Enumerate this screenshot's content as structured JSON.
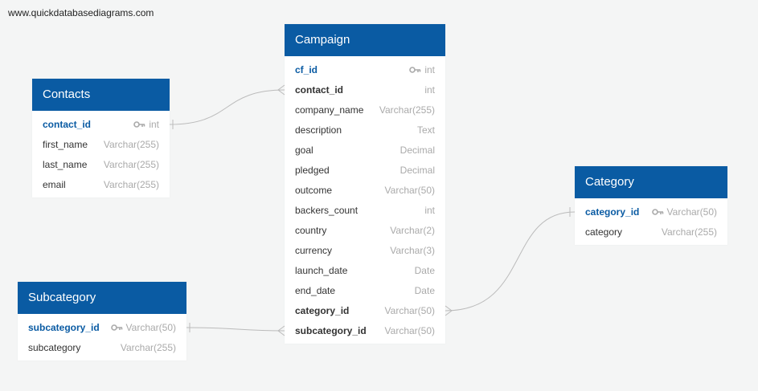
{
  "watermark": "www.quickdatabasediagrams.com",
  "colors": {
    "header": "#0a5ba3",
    "link": "#bbbbbb"
  },
  "tables": {
    "contacts": {
      "name": "Contacts",
      "fields": [
        {
          "name": "contact_id",
          "type": "int",
          "pk": true
        },
        {
          "name": "first_name",
          "type": "Varchar(255)"
        },
        {
          "name": "last_name",
          "type": "Varchar(255)"
        },
        {
          "name": "email",
          "type": "Varchar(255)"
        }
      ]
    },
    "campaign": {
      "name": "Campaign",
      "fields": [
        {
          "name": "cf_id",
          "type": "int",
          "pk": true
        },
        {
          "name": "contact_id",
          "type": "int",
          "fk": true
        },
        {
          "name": "company_name",
          "type": "Varchar(255)"
        },
        {
          "name": "description",
          "type": "Text"
        },
        {
          "name": "goal",
          "type": "Decimal"
        },
        {
          "name": "pledged",
          "type": "Decimal"
        },
        {
          "name": "outcome",
          "type": "Varchar(50)"
        },
        {
          "name": "backers_count",
          "type": "int"
        },
        {
          "name": "country",
          "type": "Varchar(2)"
        },
        {
          "name": "currency",
          "type": "Varchar(3)"
        },
        {
          "name": "launch_date",
          "type": "Date"
        },
        {
          "name": "end_date",
          "type": "Date"
        },
        {
          "name": "category_id",
          "type": "Varchar(50)",
          "fk": true
        },
        {
          "name": "subcategory_id",
          "type": "Varchar(50)",
          "fk": true
        }
      ]
    },
    "category": {
      "name": "Category",
      "fields": [
        {
          "name": "category_id",
          "type": "Varchar(50)",
          "pk": true
        },
        {
          "name": "category",
          "type": "Varchar(255)"
        }
      ]
    },
    "subcategory": {
      "name": "Subcategory",
      "fields": [
        {
          "name": "subcategory_id",
          "type": "Varchar(50)",
          "pk": true
        },
        {
          "name": "subcategory",
          "type": "Varchar(255)"
        }
      ]
    }
  }
}
